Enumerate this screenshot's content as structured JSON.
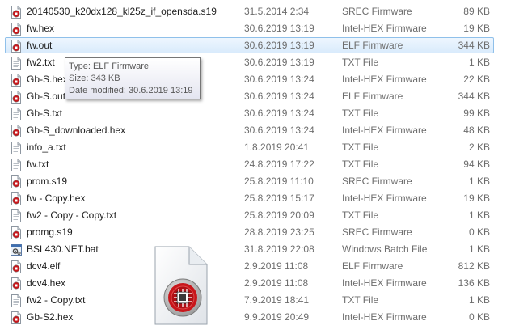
{
  "files": [
    {
      "name": "20140530_k20dx128_kl25z_if_opensda.s19",
      "date": "31.5.2014 2:34",
      "type": "SREC Firmware",
      "size": "89 KB",
      "icon": "firmware-file-icon"
    },
    {
      "name": "fw.hex",
      "date": "30.6.2019 13:19",
      "type": "Intel-HEX Firmware",
      "size": "19 KB",
      "icon": "firmware-file-icon"
    },
    {
      "name": "fw.out",
      "date": "30.6.2019 13:19",
      "type": "ELF Firmware",
      "size": "344 KB",
      "icon": "firmware-file-icon"
    },
    {
      "name": "fw2.txt",
      "date": "30.6.2019 13:19",
      "type": "TXT File",
      "size": "1 KB",
      "icon": "text-file-icon"
    },
    {
      "name": "Gb-S.hex",
      "date": "30.6.2019 13:24",
      "type": "Intel-HEX Firmware",
      "size": "22 KB",
      "icon": "firmware-file-icon"
    },
    {
      "name": "Gb-S.out",
      "date": "30.6.2019 13:24",
      "type": "ELF Firmware",
      "size": "344 KB",
      "icon": "firmware-file-icon"
    },
    {
      "name": "Gb-S.txt",
      "date": "30.6.2019 13:24",
      "type": "TXT File",
      "size": "99 KB",
      "icon": "text-file-icon"
    },
    {
      "name": "Gb-S_downloaded.hex",
      "date": "30.6.2019 13:24",
      "type": "Intel-HEX Firmware",
      "size": "48 KB",
      "icon": "firmware-file-icon"
    },
    {
      "name": "info_a.txt",
      "date": "1.8.2019 20:41",
      "type": "TXT File",
      "size": "2 KB",
      "icon": "text-file-icon"
    },
    {
      "name": "fw.txt",
      "date": "24.8.2019 17:22",
      "type": "TXT File",
      "size": "94 KB",
      "icon": "text-file-icon"
    },
    {
      "name": "prom.s19",
      "date": "25.8.2019 11:10",
      "type": "SREC Firmware",
      "size": "1 KB",
      "icon": "firmware-file-icon"
    },
    {
      "name": "fw - Copy.hex",
      "date": "25.8.2019 15:17",
      "type": "Intel-HEX Firmware",
      "size": "19 KB",
      "icon": "firmware-file-icon"
    },
    {
      "name": "fw2 - Copy - Copy.txt",
      "date": "25.8.2019 20:09",
      "type": "TXT File",
      "size": "1 KB",
      "icon": "text-file-icon"
    },
    {
      "name": "promg.s19",
      "date": "28.8.2019 23:25",
      "type": "SREC Firmware",
      "size": "0 KB",
      "icon": "firmware-file-icon"
    },
    {
      "name": "BSL430.NET.bat",
      "date": "31.8.2019 22:08",
      "type": "Windows Batch File",
      "size": "1 KB",
      "icon": "batch-file-icon"
    },
    {
      "name": "dcv4.elf",
      "date": "2.9.2019 11:08",
      "type": "ELF Firmware",
      "size": "812 KB",
      "icon": "firmware-file-icon"
    },
    {
      "name": "dcv4.hex",
      "date": "2.9.2019 11:08",
      "type": "Intel-HEX Firmware",
      "size": "136 KB",
      "icon": "firmware-file-icon"
    },
    {
      "name": "fw2 - Copy.txt",
      "date": "7.9.2019 18:41",
      "type": "TXT File",
      "size": "1 KB",
      "icon": "text-file-icon"
    },
    {
      "name": "Gb-S2.hex",
      "date": "9.9.2019 20:49",
      "type": "Intel-HEX Firmware",
      "size": "0 KB",
      "icon": "firmware-file-icon"
    }
  ],
  "selected_index": 2,
  "tooltip": {
    "type_line": "Type: ELF Firmware",
    "size_line": "Size: 343 KB",
    "modified_line": "Date modified: 30.6.2019 13:19"
  },
  "drag_icon": "firmware-file-icon",
  "colors": {
    "firmware_badge": "#cc1f1f",
    "selection_border": "#8fc0ea",
    "secondary_text": "#6d6d6d"
  }
}
